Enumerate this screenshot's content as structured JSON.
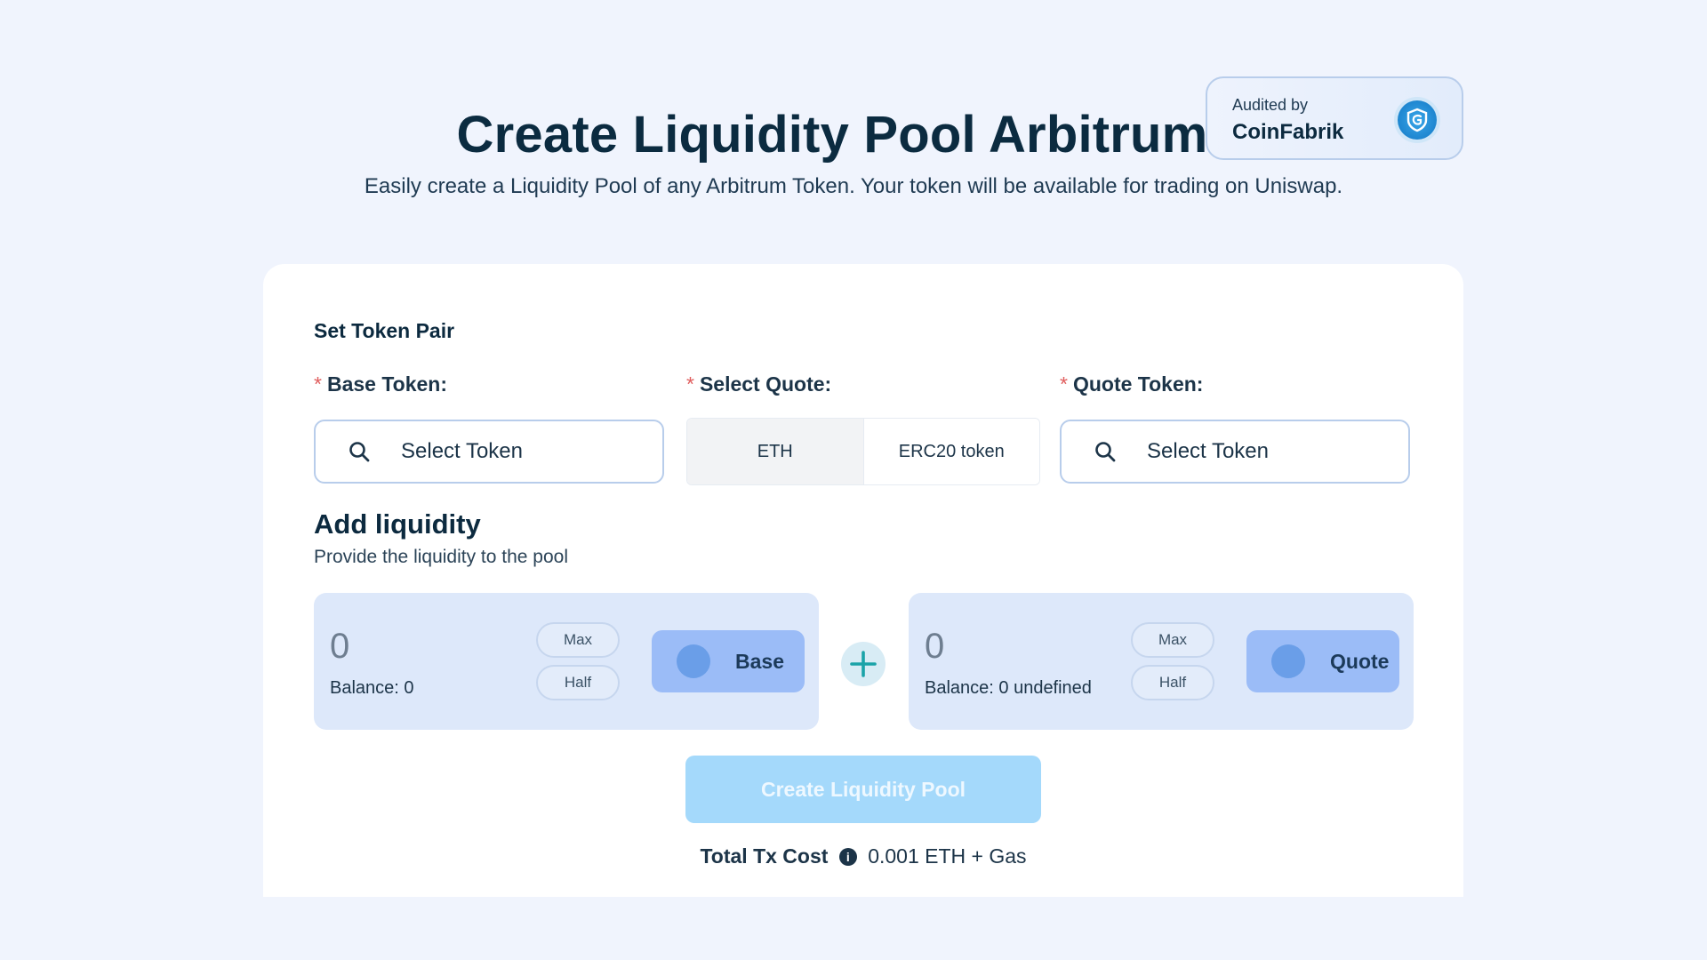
{
  "header": {
    "title": "Create Liquidity Pool Arbitrum",
    "subtitle": "Easily create a Liquidity Pool of any Arbitrum Token. Your token will be available for trading on Uniswap."
  },
  "audit": {
    "label": "Audited by",
    "name": "CoinFabrik",
    "logo_icon": "coinfabrik-shield-icon"
  },
  "token_pair": {
    "section_title": "Set Token Pair",
    "base_label": "Base Token:",
    "quote_select_label": "Select Quote:",
    "quote_token_label": "Quote Token:",
    "required_mark": "*",
    "base_placeholder": "Select Token",
    "quote_placeholder": "Select Token",
    "quote_options": [
      "ETH",
      "ERC20 token"
    ],
    "quote_selected": "ETH"
  },
  "liquidity": {
    "title": "Add liquidity",
    "subtitle": "Provide the liquidity to the pool",
    "base": {
      "amount": "0",
      "balance": "Balance: 0",
      "max_label": "Max",
      "half_label": "Half",
      "token_label": "Base"
    },
    "quote": {
      "amount": "0",
      "balance": "Balance: 0 undefined",
      "max_label": "Max",
      "half_label": "Half",
      "token_label": "Quote"
    }
  },
  "actions": {
    "create_label": "Create Liquidity Pool"
  },
  "cost": {
    "label": "Total Tx Cost",
    "info_glyph": "i",
    "value": "0.001 ETH + Gas"
  },
  "colors": {
    "background": "#f0f4fd",
    "primary_text": "#0c2a3f",
    "required": "#e05d5d",
    "button_disabled": "#a4d9fb",
    "token_button": "#9bbcf7",
    "liquidity_box": "#dde8fa"
  }
}
